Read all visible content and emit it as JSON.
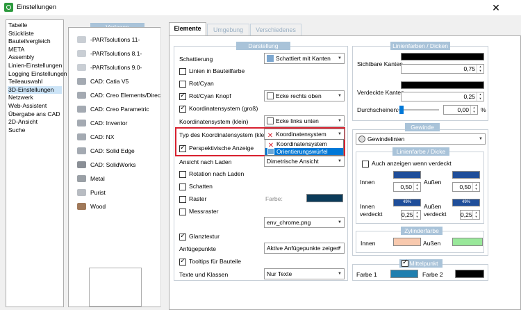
{
  "window": {
    "title": "Einstellungen",
    "close": "✕"
  },
  "nav": {
    "items": [
      "Tabelle",
      "Stückliste",
      "Bauteilvergleich",
      "META",
      "Assembly",
      "Linien-Einstellungen",
      "Logging Einstellungen",
      "Teileauswahl",
      "3D-Einstellungen",
      "Netzwerk",
      "Web-Assistent",
      "Übergabe ans CAD",
      "2D-Ansicht",
      "Suche"
    ],
    "selected": "3D-Einstellungen"
  },
  "templates": {
    "title": "Vorlagen",
    "items": [
      "-PARTsolutions 11-",
      "-PARTsolutions 8.1-",
      "-PARTsolutions 9.0-",
      "CAD: Catia V5",
      "CAD: Creo Elements/Direct M",
      "CAD: Creo Parametric",
      "CAD: Inventor",
      "CAD: NX",
      "CAD: Solid Edge",
      "CAD: SolidWorks",
      "Metal",
      "Purist",
      "Wood"
    ]
  },
  "tabs": [
    "Elemente",
    "Umgebung",
    "Verschiedenes"
  ],
  "darstellung": {
    "title": "Darstellung",
    "schattierung_label": "Schattierung",
    "schattierung_value": "Schattiert mit Kanten",
    "linien_bauteilfarbe": "Linien in Bauteilfarbe",
    "rot_cyan": "Rot/Cyan",
    "rot_cyan_knopf": "Rot/Cyan Knopf",
    "rot_cyan_knopf_value": "Ecke rechts oben",
    "koord_gross": "Koordinatensystem (groß)",
    "koord_klein": "Koordinatensystem (klein)",
    "koord_klein_value": "Ecke links unten",
    "typ_koord": "Typ des Koordinatensystem (klein)",
    "typ_koord_value": "Koordinatensystem",
    "typ_options": [
      "Koordinatensystem",
      "Orientierungswürfel"
    ],
    "perspektivisch": "Perspektivische Anzeige",
    "ansicht_nach_laden": "Ansicht nach Laden",
    "ansicht_value": "Dimetrische Ansicht",
    "rotation": "Rotation nach Laden",
    "schatten": "Schatten",
    "raster": "Raster",
    "farbe": "Farbe:",
    "messraster": "Messraster",
    "env_value": "env_chrome.png",
    "glanztextur": "Glanztextur",
    "anfuegepunkte": "Anfügepunkte",
    "anfuegepunkte_value": "Aktive Anfügepunkte zeigen",
    "tooltips": "Tooltips für Bauteile",
    "texte_klassen": "Texte und Klassen",
    "texte_value": "Nur Texte"
  },
  "linienfarben": {
    "title": "Linienfarben / Dicken",
    "sichtbare": "Sichtbare Kanten",
    "sichtbare_value": "0,75",
    "verdeckte": "Verdeckte Kanten",
    "verdeckte_value": "0,25",
    "durchscheinen": "Durchscheinen:",
    "durchscheinen_value": "0,00",
    "percent": "%"
  },
  "gewinde": {
    "title": "Gewinde",
    "value": "Gewindelinien",
    "linienfarbe_title": "Linienfarbe / Dicke",
    "auch_anzeigen": "Auch anzeigen wenn verdeckt",
    "innen": "Innen",
    "aussen": "Außen",
    "innen_value": "0,50",
    "aussen_value": "0,50",
    "innen_verdeckt_1": "Innen",
    "innen_verdeckt_2": "verdeckt",
    "aussen_verdeckt_1": "Außen",
    "aussen_verdeckt_2": "verdeckt",
    "swatch_pct_1": "49%",
    "swatch_pct_2": "49%",
    "innen_verdeckt_value": "0,25",
    "aussen_verdeckt_value": "0,25"
  },
  "zylinderfarbe": {
    "title": "Zylinderfarbe",
    "innen": "Innen",
    "aussen": "Außen"
  },
  "mittelpunkt": {
    "title": "Mittelpunkt",
    "farbe1": "Farbe 1",
    "farbe2": "Farbe 2"
  },
  "colors": {
    "group_title_bg": "#a9c3d9",
    "selection": "#cce4f7",
    "highlight_red": "#d8202f",
    "gewinde_blue": "#1f4e9a",
    "zylinder_innen": "#f8c9ae",
    "zylinder_aussen": "#99e89a",
    "mittelpunkt_1": "#1f7faf",
    "mittelpunkt_2": "#000000",
    "raster_farbe": "#0b3b5a"
  }
}
